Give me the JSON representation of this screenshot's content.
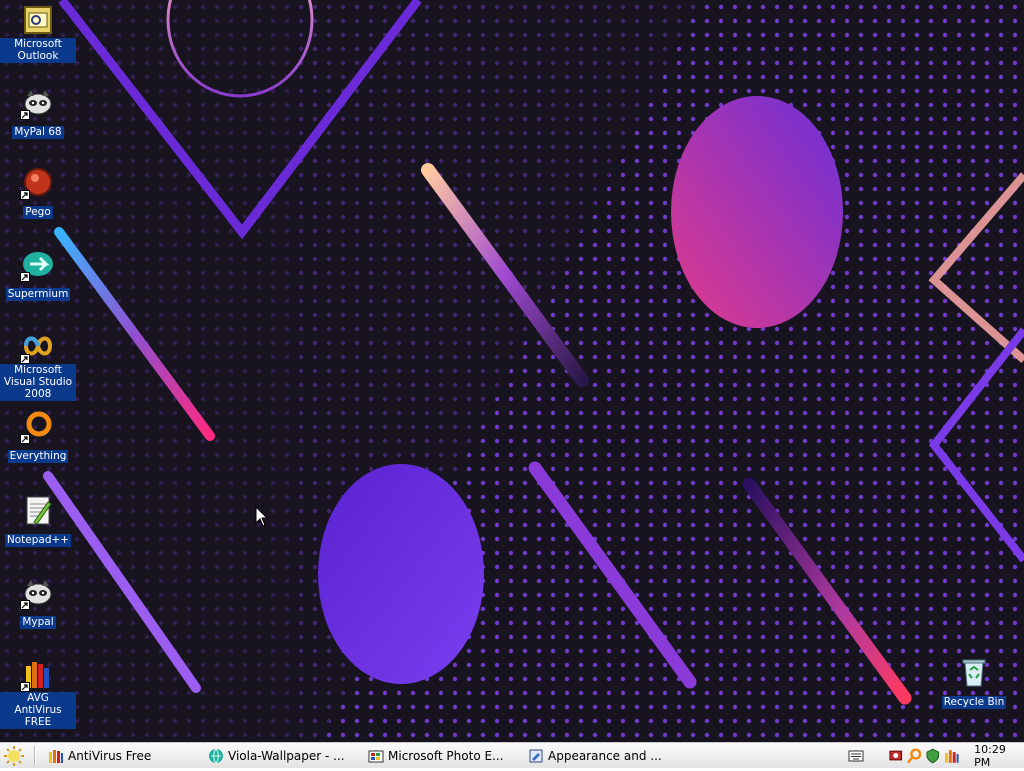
{
  "desktop": {
    "icons": [
      {
        "label": "Microsoft Outlook",
        "icon": "outlook-icon",
        "shortcut": false
      },
      {
        "label": "MyPal 68",
        "icon": "mypal-raccoon-icon",
        "shortcut": true
      },
      {
        "label": "Pego",
        "icon": "pego-icon",
        "shortcut": true
      },
      {
        "label": "Supermium",
        "icon": "supermium-icon",
        "shortcut": true
      },
      {
        "label": "Microsoft Visual Studio 2008",
        "icon": "visual-studio-icon",
        "shortcut": true
      },
      {
        "label": "Everything",
        "icon": "everything-search-icon",
        "shortcut": true
      },
      {
        "label": "Notepad++",
        "icon": "notepadpp-icon",
        "shortcut": false
      },
      {
        "label": "Mypal",
        "icon": "mypal-raccoon-icon",
        "shortcut": true
      },
      {
        "label": "AVG AntiVirus FREE",
        "icon": "avg-icon",
        "shortcut": true
      }
    ],
    "recycle_bin": {
      "label": "Recycle Bin",
      "icon": "recycle-bin-icon"
    }
  },
  "taskbar": {
    "buttons": [
      {
        "label": "AntiVirus Free",
        "icon": "avg-window-icon"
      },
      {
        "label": "Viola-Wallpaper - ...",
        "icon": "browser-globe-icon"
      },
      {
        "label": "Microsoft Photo E...",
        "icon": "photo-editor-icon"
      },
      {
        "label": "Appearance and ...",
        "icon": "control-panel-icon"
      }
    ],
    "tray_icons": [
      "keyboard-icon",
      "network-icon",
      "search-tray-icon",
      "security-icon",
      "avg-tray-icon"
    ],
    "clock": "10:29 PM"
  },
  "colors": {
    "wallpaper_bg": "#17141f",
    "dots": "#7b3fe0",
    "label_bg": "#0b3a8c",
    "taskbar": "#f0f0f0"
  }
}
